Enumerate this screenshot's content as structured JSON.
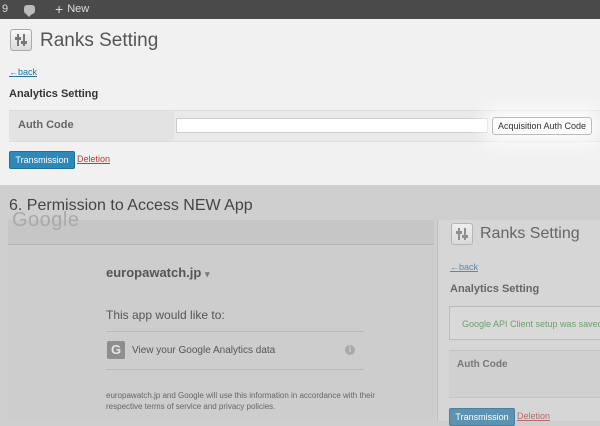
{
  "admin_bar": {
    "count": "9",
    "new_label": "New"
  },
  "top_panel": {
    "page_title": "Ranks Setting",
    "back_link": "←back",
    "section_title": "Analytics Setting",
    "auth_code_label": "Auth Code",
    "auth_code_value": "",
    "acquire_button": "Acquisition Auth Code",
    "transmission_button": "Transmission",
    "deletion_link": "Deletion"
  },
  "step_heading": "6. Permission to Access NEW App",
  "google_consent": {
    "logo_text": "Google",
    "domain": "europawatch.jp",
    "intro": "This app would like to:",
    "permission_icon": "G",
    "permission": "View your Google Analytics data",
    "info_icon": "i",
    "footer_text": "europawatch.jp and Google will use this information in accordance with their respective terms of service and privacy policies."
  },
  "right_snapshot": {
    "page_title": "Ranks Setting",
    "back_link": "←back",
    "section_title": "Analytics Setting",
    "notice": "Google API Client setup was saved.",
    "auth_code_label": "Auth Code",
    "transmission_button": "Transmission",
    "deletion_link": "Deletion"
  },
  "colors": {
    "admin_bar": "#4a4a4a",
    "primary_button": "#2e89b8",
    "link": "#21759b",
    "notice_text": "#6f9d6f"
  }
}
